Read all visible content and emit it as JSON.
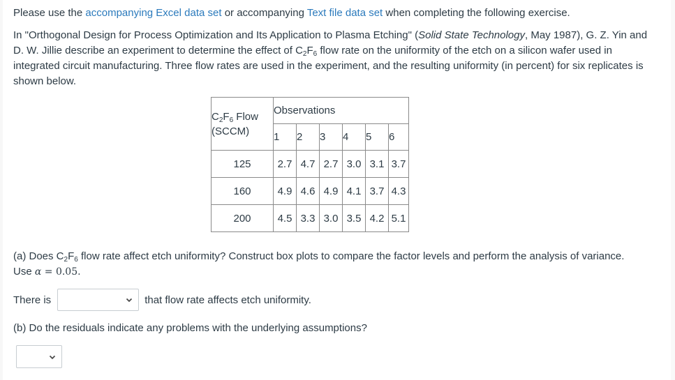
{
  "intro": {
    "prefix": "Please use the ",
    "link_excel": "accompanying Excel data set",
    "middle": " or accompanying ",
    "link_text": "Text file data set",
    "suffix": " when completing the following exercise."
  },
  "problem": {
    "part1": "In \"Orthogonal Design for Process Optimization and Its Application to Plasma Etching\" (",
    "journal": "Solid State Technology",
    "part2": ", May 1987), G. Z. Yin and D. W. Jillie describe an experiment to determine the effect of C",
    "sub1": "2",
    "part3": "F",
    "sub2": "6",
    "part4": " flow rate on the uniformity of the etch on a silicon wafer used in integrated circuit manufacturing. Three flow rates are used in the experiment, and the resulting uniformity (in percent) for six replicates is shown below."
  },
  "table": {
    "flow_header": {
      "c": "C",
      "sub1": "2",
      "f": "F",
      "sub2": "6",
      "label": " Flow",
      "unit": "(SCCM)"
    },
    "observations_header": "Observations",
    "obs_numbers": [
      "1",
      "2",
      "3",
      "4",
      "5",
      "6"
    ],
    "rows": [
      {
        "flow": "125",
        "values": [
          "2.7",
          "4.7",
          "2.7",
          "3.0",
          "3.1",
          "3.7"
        ]
      },
      {
        "flow": "160",
        "values": [
          "4.9",
          "4.6",
          "4.9",
          "4.1",
          "3.7",
          "4.3"
        ]
      },
      {
        "flow": "200",
        "values": [
          "4.5",
          "3.3",
          "3.0",
          "3.5",
          "4.2",
          "5.1"
        ]
      }
    ]
  },
  "part_a": {
    "q_prefix": "(a) Does C",
    "sub1": "2",
    "f": "F",
    "sub2": "6",
    "q_rest": " flow rate affect etch uniformity? Construct box plots to compare the factor levels and perform the analysis of variance.",
    "use": "Use ",
    "alpha_symbol": "α",
    "alpha_eq": " = 0.05.",
    "answer_prefix": "There is",
    "answer_selected": "",
    "answer_suffix": "that flow rate affects etch uniformity."
  },
  "part_b": {
    "question": "(b) Do the residuals indicate any problems with the underlying assumptions?",
    "answer_selected": ""
  },
  "icons": {
    "dropdown": "chevron-down-icon"
  },
  "colors": {
    "text": "#2d3b45",
    "link": "#2b7abc",
    "border": "#8a8a8a",
    "select_border": "#c7cdd1"
  }
}
